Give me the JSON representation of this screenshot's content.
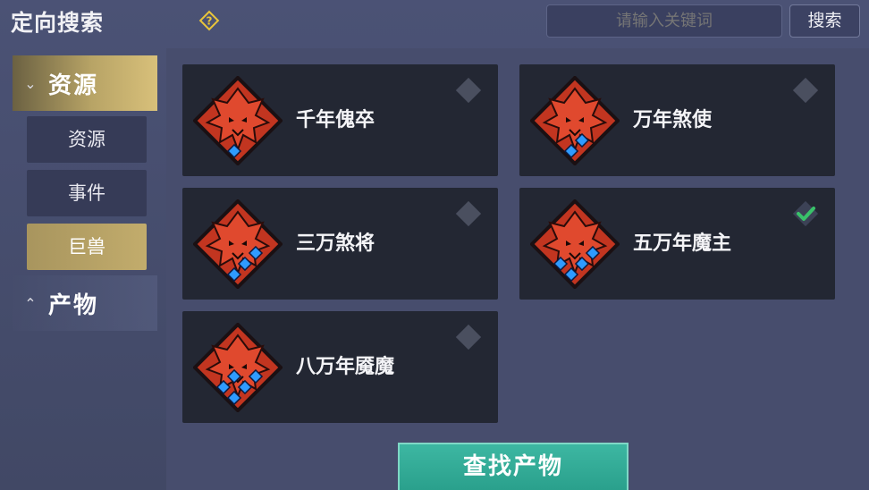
{
  "header": {
    "title": "定向搜索",
    "search_placeholder": "请输入关键词",
    "search_button": "搜索"
  },
  "sidebar": {
    "categories": [
      {
        "label": "资源",
        "expanded": true,
        "active": true
      },
      {
        "label": "产物",
        "expanded": false,
        "active": false
      }
    ],
    "subitems": [
      {
        "label": "资源",
        "active": false
      },
      {
        "label": "事件",
        "active": false
      },
      {
        "label": "巨兽",
        "active": true
      }
    ]
  },
  "cards": [
    {
      "name": "千年傀卒",
      "pips": 1,
      "checked": false
    },
    {
      "name": "万年煞使",
      "pips": 2,
      "checked": false
    },
    {
      "name": "三万煞将",
      "pips": 3,
      "checked": false
    },
    {
      "name": "五万年魔主",
      "pips": 4,
      "checked": true
    },
    {
      "name": "八万年魇魔",
      "pips": 5,
      "checked": false
    }
  ],
  "find_button": "查找产物",
  "colors": {
    "accent_gold": "#c2ac6c",
    "accent_teal": "#2aa08c",
    "emblem_red": "#d13a25",
    "pip_blue": "#2f9bff",
    "check_green": "#39c26a"
  }
}
